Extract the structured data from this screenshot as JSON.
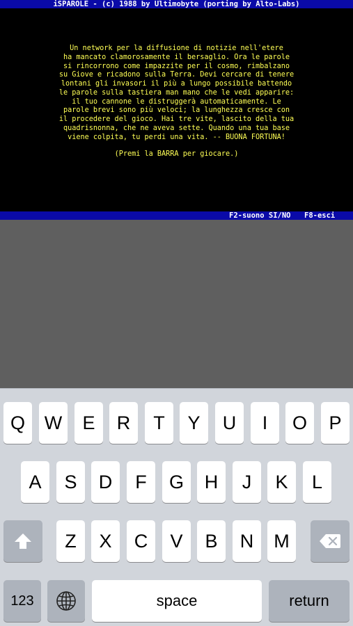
{
  "app": {
    "title": "iSPAROLE - (c) 1988 by Ultimobyte (porting by Alto-Labs)"
  },
  "screen": {
    "lines": [
      "Un network per la diffusione di notizie nell'etere",
      "ha mancato clamorosamente il bersaglio.  Ora le parole",
      "si rincorrono come impazzite per il cosmo, rimbalzano",
      "su Giove e ricadono sulla Terra. Devi cercare di tenere",
      "lontani gli invasori il più a lungo possibile battendo",
      "le parole sulla tastiera man mano che le vedi apparire:",
      "il tuo cannone le distruggerà automaticamente. Le",
      "parole brevi sono più veloci; la lunghezza cresce con",
      "il procedere del gioco. Hai tre vite, lascito della tua",
      "quadrisnonna, che ne aveva sette. Quando una tua base",
      "viene colpita, tu perdi una vita. -- BUONA FORTUNA!"
    ],
    "prompt": "(Premi la BARRA per giocare.)"
  },
  "status": {
    "sound": "F2-suono SI/NO",
    "exit": "F8-esci"
  },
  "keyboard": {
    "row1": [
      "Q",
      "W",
      "E",
      "R",
      "T",
      "Y",
      "U",
      "I",
      "O",
      "P"
    ],
    "row2": [
      "A",
      "S",
      "D",
      "F",
      "G",
      "H",
      "J",
      "K",
      "L"
    ],
    "row3": [
      "Z",
      "X",
      "C",
      "V",
      "B",
      "N",
      "M"
    ],
    "numbers_label": "123",
    "space_label": "space",
    "return_label": "return",
    "icons": {
      "shift": "shift-icon",
      "delete": "delete-icon",
      "globe": "globe-icon"
    },
    "colors": {
      "background": "#d1d5db",
      "key": "#ffffff",
      "function_key": "#adb3bc"
    }
  },
  "colors": {
    "title_bar": "#0a0aa8",
    "screen_background": "#000000",
    "screen_text": "#ffff55"
  }
}
